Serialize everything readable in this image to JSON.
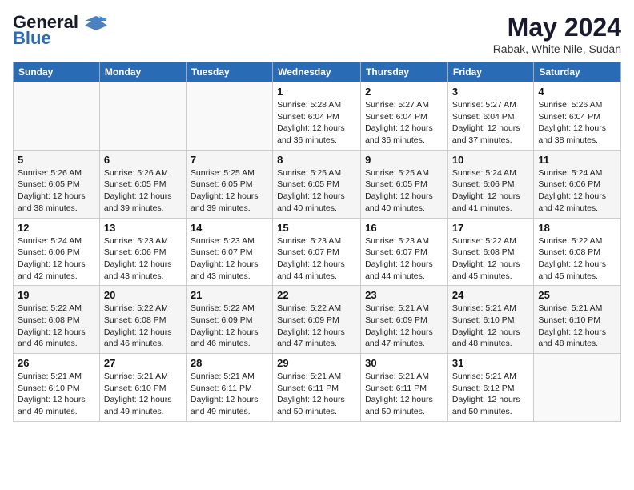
{
  "logo": {
    "line1": "General",
    "line2": "Blue"
  },
  "title": "May 2024",
  "location": "Rabak, White Nile, Sudan",
  "days_of_week": [
    "Sunday",
    "Monday",
    "Tuesday",
    "Wednesday",
    "Thursday",
    "Friday",
    "Saturday"
  ],
  "weeks": [
    [
      {
        "day": "",
        "sunrise": "",
        "sunset": "",
        "daylight": ""
      },
      {
        "day": "",
        "sunrise": "",
        "sunset": "",
        "daylight": ""
      },
      {
        "day": "",
        "sunrise": "",
        "sunset": "",
        "daylight": ""
      },
      {
        "day": "1",
        "sunrise": "Sunrise: 5:28 AM",
        "sunset": "Sunset: 6:04 PM",
        "daylight": "Daylight: 12 hours and 36 minutes."
      },
      {
        "day": "2",
        "sunrise": "Sunrise: 5:27 AM",
        "sunset": "Sunset: 6:04 PM",
        "daylight": "Daylight: 12 hours and 36 minutes."
      },
      {
        "day": "3",
        "sunrise": "Sunrise: 5:27 AM",
        "sunset": "Sunset: 6:04 PM",
        "daylight": "Daylight: 12 hours and 37 minutes."
      },
      {
        "day": "4",
        "sunrise": "Sunrise: 5:26 AM",
        "sunset": "Sunset: 6:04 PM",
        "daylight": "Daylight: 12 hours and 38 minutes."
      }
    ],
    [
      {
        "day": "5",
        "sunrise": "Sunrise: 5:26 AM",
        "sunset": "Sunset: 6:05 PM",
        "daylight": "Daylight: 12 hours and 38 minutes."
      },
      {
        "day": "6",
        "sunrise": "Sunrise: 5:26 AM",
        "sunset": "Sunset: 6:05 PM",
        "daylight": "Daylight: 12 hours and 39 minutes."
      },
      {
        "day": "7",
        "sunrise": "Sunrise: 5:25 AM",
        "sunset": "Sunset: 6:05 PM",
        "daylight": "Daylight: 12 hours and 39 minutes."
      },
      {
        "day": "8",
        "sunrise": "Sunrise: 5:25 AM",
        "sunset": "Sunset: 6:05 PM",
        "daylight": "Daylight: 12 hours and 40 minutes."
      },
      {
        "day": "9",
        "sunrise": "Sunrise: 5:25 AM",
        "sunset": "Sunset: 6:05 PM",
        "daylight": "Daylight: 12 hours and 40 minutes."
      },
      {
        "day": "10",
        "sunrise": "Sunrise: 5:24 AM",
        "sunset": "Sunset: 6:06 PM",
        "daylight": "Daylight: 12 hours and 41 minutes."
      },
      {
        "day": "11",
        "sunrise": "Sunrise: 5:24 AM",
        "sunset": "Sunset: 6:06 PM",
        "daylight": "Daylight: 12 hours and 42 minutes."
      }
    ],
    [
      {
        "day": "12",
        "sunrise": "Sunrise: 5:24 AM",
        "sunset": "Sunset: 6:06 PM",
        "daylight": "Daylight: 12 hours and 42 minutes."
      },
      {
        "day": "13",
        "sunrise": "Sunrise: 5:23 AM",
        "sunset": "Sunset: 6:06 PM",
        "daylight": "Daylight: 12 hours and 43 minutes."
      },
      {
        "day": "14",
        "sunrise": "Sunrise: 5:23 AM",
        "sunset": "Sunset: 6:07 PM",
        "daylight": "Daylight: 12 hours and 43 minutes."
      },
      {
        "day": "15",
        "sunrise": "Sunrise: 5:23 AM",
        "sunset": "Sunset: 6:07 PM",
        "daylight": "Daylight: 12 hours and 44 minutes."
      },
      {
        "day": "16",
        "sunrise": "Sunrise: 5:23 AM",
        "sunset": "Sunset: 6:07 PM",
        "daylight": "Daylight: 12 hours and 44 minutes."
      },
      {
        "day": "17",
        "sunrise": "Sunrise: 5:22 AM",
        "sunset": "Sunset: 6:08 PM",
        "daylight": "Daylight: 12 hours and 45 minutes."
      },
      {
        "day": "18",
        "sunrise": "Sunrise: 5:22 AM",
        "sunset": "Sunset: 6:08 PM",
        "daylight": "Daylight: 12 hours and 45 minutes."
      }
    ],
    [
      {
        "day": "19",
        "sunrise": "Sunrise: 5:22 AM",
        "sunset": "Sunset: 6:08 PM",
        "daylight": "Daylight: 12 hours and 46 minutes."
      },
      {
        "day": "20",
        "sunrise": "Sunrise: 5:22 AM",
        "sunset": "Sunset: 6:08 PM",
        "daylight": "Daylight: 12 hours and 46 minutes."
      },
      {
        "day": "21",
        "sunrise": "Sunrise: 5:22 AM",
        "sunset": "Sunset: 6:09 PM",
        "daylight": "Daylight: 12 hours and 46 minutes."
      },
      {
        "day": "22",
        "sunrise": "Sunrise: 5:22 AM",
        "sunset": "Sunset: 6:09 PM",
        "daylight": "Daylight: 12 hours and 47 minutes."
      },
      {
        "day": "23",
        "sunrise": "Sunrise: 5:21 AM",
        "sunset": "Sunset: 6:09 PM",
        "daylight": "Daylight: 12 hours and 47 minutes."
      },
      {
        "day": "24",
        "sunrise": "Sunrise: 5:21 AM",
        "sunset": "Sunset: 6:10 PM",
        "daylight": "Daylight: 12 hours and 48 minutes."
      },
      {
        "day": "25",
        "sunrise": "Sunrise: 5:21 AM",
        "sunset": "Sunset: 6:10 PM",
        "daylight": "Daylight: 12 hours and 48 minutes."
      }
    ],
    [
      {
        "day": "26",
        "sunrise": "Sunrise: 5:21 AM",
        "sunset": "Sunset: 6:10 PM",
        "daylight": "Daylight: 12 hours and 49 minutes."
      },
      {
        "day": "27",
        "sunrise": "Sunrise: 5:21 AM",
        "sunset": "Sunset: 6:10 PM",
        "daylight": "Daylight: 12 hours and 49 minutes."
      },
      {
        "day": "28",
        "sunrise": "Sunrise: 5:21 AM",
        "sunset": "Sunset: 6:11 PM",
        "daylight": "Daylight: 12 hours and 49 minutes."
      },
      {
        "day": "29",
        "sunrise": "Sunrise: 5:21 AM",
        "sunset": "Sunset: 6:11 PM",
        "daylight": "Daylight: 12 hours and 50 minutes."
      },
      {
        "day": "30",
        "sunrise": "Sunrise: 5:21 AM",
        "sunset": "Sunset: 6:11 PM",
        "daylight": "Daylight: 12 hours and 50 minutes."
      },
      {
        "day": "31",
        "sunrise": "Sunrise: 5:21 AM",
        "sunset": "Sunset: 6:12 PM",
        "daylight": "Daylight: 12 hours and 50 minutes."
      },
      {
        "day": "",
        "sunrise": "",
        "sunset": "",
        "daylight": ""
      }
    ]
  ]
}
